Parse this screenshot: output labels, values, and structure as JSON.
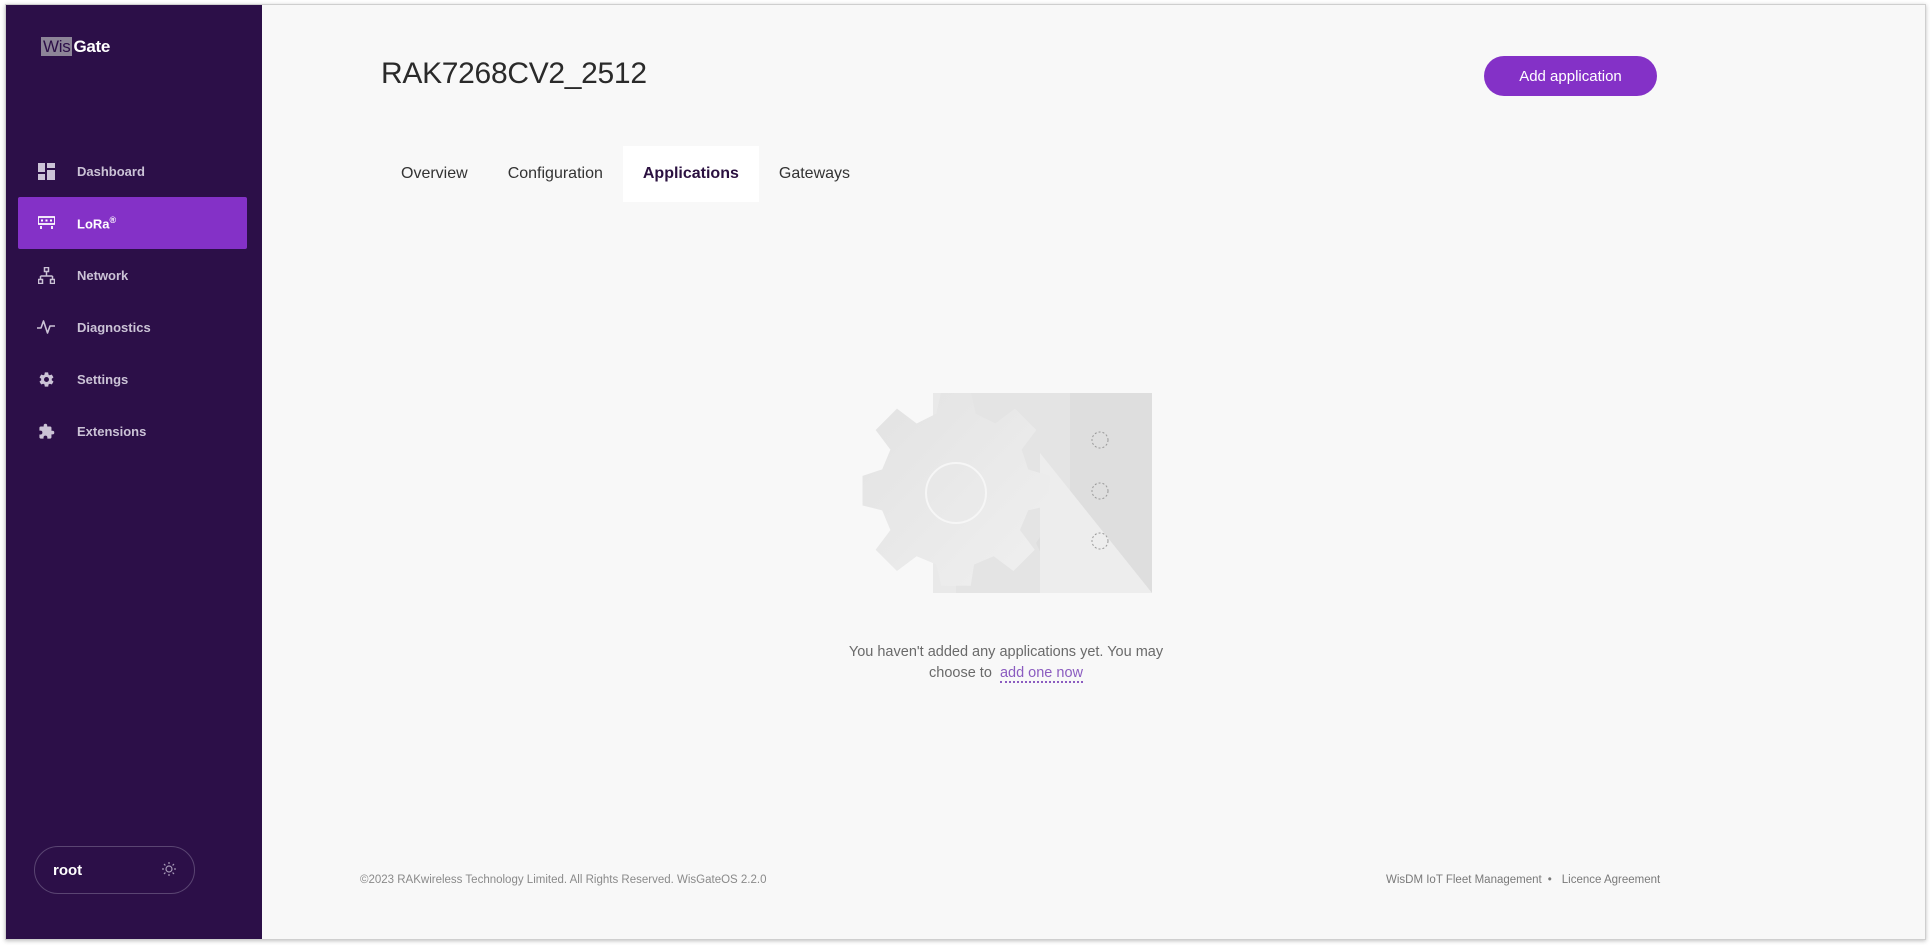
{
  "brand": {
    "wis": "Wis",
    "gate": "Gate"
  },
  "sidebar": {
    "items": [
      {
        "label": "Dashboard",
        "icon": "dashboard-icon"
      },
      {
        "label": "LoRa",
        "sup": "®",
        "icon": "lora-icon",
        "active": true
      },
      {
        "label": "Network",
        "icon": "network-icon"
      },
      {
        "label": "Diagnostics",
        "icon": "diagnostics-icon"
      },
      {
        "label": "Settings",
        "icon": "gear-icon"
      },
      {
        "label": "Extensions",
        "icon": "puzzle-icon"
      }
    ],
    "user": "root",
    "theme_icon": "sun-icon"
  },
  "header": {
    "title": "RAK7268CV2_2512",
    "add_button": "Add application"
  },
  "tabs": [
    {
      "label": "Overview"
    },
    {
      "label": "Configuration"
    },
    {
      "label": "Applications",
      "active": true
    },
    {
      "label": "Gateways"
    }
  ],
  "empty_state": {
    "text": "You haven't added any applications yet. You may choose to",
    "link": "add one now"
  },
  "footer": {
    "copyright": "©2023 RAKwireless Technology Limited. All Rights Reserved. WisGateOS 2.2.0",
    "link1": "WisDM IoT Fleet Management",
    "separator": "•",
    "link2": "Licence Agreement"
  },
  "colors": {
    "sidebar_bg": "#2c0f48",
    "accent": "#8431c7",
    "page_bg": "#f8f8f8"
  }
}
